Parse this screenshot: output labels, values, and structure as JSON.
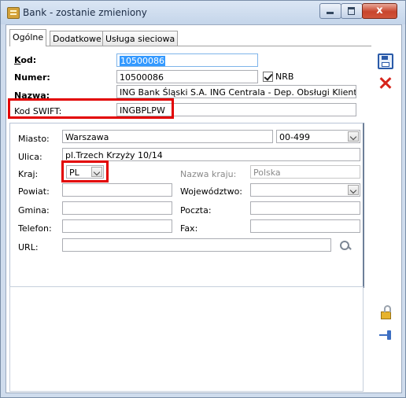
{
  "window": {
    "title": "Bank - zostanie zmieniony",
    "close_label": "x"
  },
  "tabs": [
    "Ogólne",
    "Dodatkowe",
    "Usługa sieciowa"
  ],
  "form": {
    "kod_label": "Kod:",
    "kod_value": "10500086",
    "numer_label": "Numer:",
    "numer_value": "10500086",
    "nrb_label": "NRB",
    "nrb_checked": true,
    "nazwa_label": "Nazwa:",
    "nazwa_value": "ING Bank Śląski S.A. ING   Centrala - Dep. Obsługi Klientów",
    "swift_label": "Kod SWIFT:",
    "swift_value": "INGBPLPW"
  },
  "address": {
    "miasto_label": "Miasto:",
    "miasto_value": "Warszawa",
    "kod_pocztowy_value": "00-499",
    "ulica_label": "Ulica:",
    "ulica_value": "pl.Trzech Krzyży 10/14",
    "kraj_label": "Kraj:",
    "kraj_value": "PL",
    "nazwa_kraju_label": "Nazwa kraju:",
    "nazwa_kraju_value": "Polska",
    "powiat_label": "Powiat:",
    "powiat_value": "",
    "wojewodztwo_label": "Województwo:",
    "wojewodztwo_value": "",
    "gmina_label": "Gmina:",
    "gmina_value": "",
    "poczta_label": "Poczta:",
    "poczta_value": "",
    "telefon_label": "Telefon:",
    "telefon_value": "",
    "fax_label": "Fax:",
    "fax_value": "",
    "url_label": "URL:",
    "url_value": ""
  },
  "icons": [
    "app-icon",
    "minimize-icon",
    "maximize-icon",
    "close-icon",
    "save-icon",
    "cancel-icon",
    "lock-icon",
    "pin-icon",
    "url-search-icon"
  ],
  "colors": {
    "highlight": "#e20000",
    "selection": "#3399ff",
    "close_button": "#c8452c"
  }
}
